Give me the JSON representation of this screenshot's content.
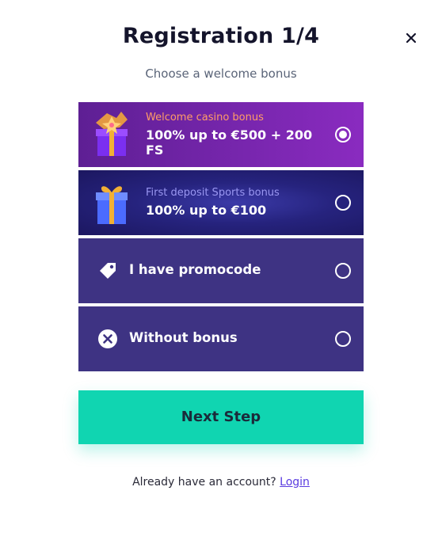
{
  "header": {
    "title": "Registration 1/4",
    "subtitle": "Choose a welcome bonus",
    "close_icon": "close-icon"
  },
  "options": [
    {
      "id": "casino",
      "small_label": "Welcome casino bonus",
      "big_label": "100% up to €500 + 200 FS",
      "icon": "gift-sparkle-icon",
      "selected": true,
      "accent": "#ff9d66"
    },
    {
      "id": "sports",
      "small_label": "First deposit Sports bonus",
      "big_label": "100% up to €100",
      "icon": "gift-icon",
      "selected": false,
      "accent": "#9a97f2"
    },
    {
      "id": "promo",
      "label": "I have promocode",
      "icon": "tag-icon",
      "selected": false
    },
    {
      "id": "none",
      "label": "Without bonus",
      "icon": "x-circle-icon",
      "selected": false
    }
  ],
  "next_button": {
    "label": "Next Step",
    "color": "#10d5b1"
  },
  "footer": {
    "text": "Already have an account?",
    "login_link": "Login",
    "link_color": "#5a3be0"
  }
}
